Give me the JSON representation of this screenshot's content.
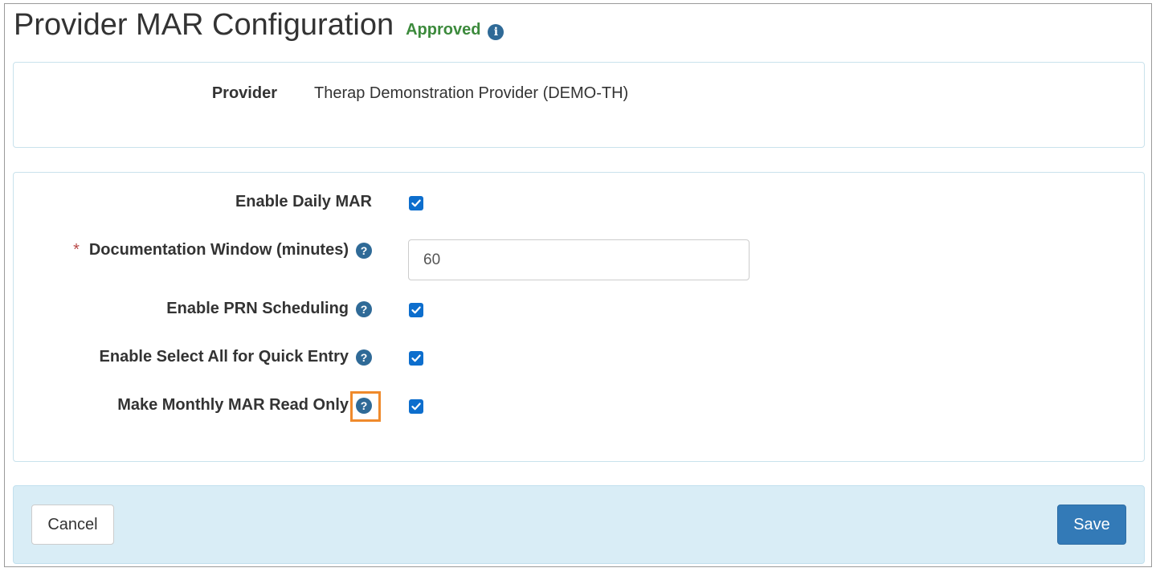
{
  "header": {
    "title": "Provider MAR Configuration",
    "status": "Approved",
    "status_color": "#3c8a3c",
    "info_icon": "info-circle-icon"
  },
  "provider": {
    "label": "Provider",
    "value": "Therap Demonstration Provider (DEMO-TH)"
  },
  "settings": {
    "daily_mar": {
      "label": "Enable Daily MAR",
      "checked": true
    },
    "doc_window": {
      "required_mark": "*",
      "label": "Documentation Window (minutes)",
      "value": "60",
      "help_icon": "question-circle-icon"
    },
    "prn": {
      "label": "Enable PRN Scheduling",
      "checked": true,
      "help_icon": "question-circle-icon"
    },
    "select_all": {
      "label": "Enable Select All for Quick Entry",
      "checked": true,
      "help_icon": "question-circle-icon"
    },
    "monthly_read_only": {
      "label": "Make Monthly MAR Read Only",
      "checked": true,
      "help_icon": "question-circle-icon",
      "help_highlighted": true
    }
  },
  "footer": {
    "cancel_label": "Cancel",
    "save_label": "Save"
  },
  "colors": {
    "primary": "#337ab7",
    "checkbox": "#0d6ecd",
    "highlight": "#ef8a2c",
    "footer_bg": "#d9edf6"
  }
}
